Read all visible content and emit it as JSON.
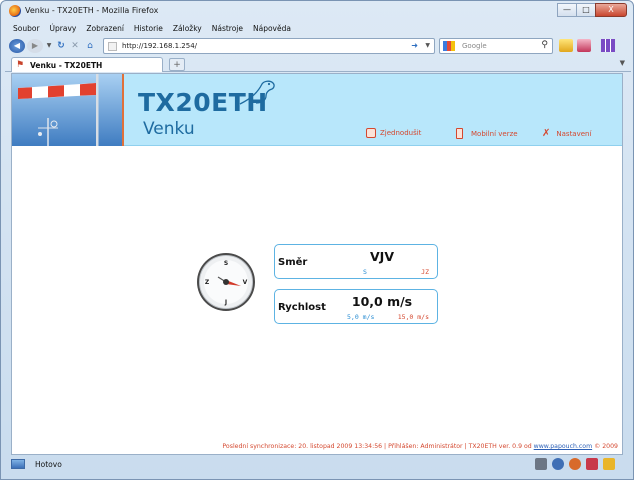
{
  "window": {
    "title": "Venku - TX20ETH - Mozilla Firefox",
    "controls": {
      "minimize": "—",
      "maximize": "□",
      "close": "X"
    }
  },
  "menu": [
    "Soubor",
    "Úpravy",
    "Zobrazení",
    "Historie",
    "Záložky",
    "Nástroje",
    "Nápověda"
  ],
  "nav": {
    "url": "http://192.168.1.254/",
    "search_placeholder": "Google"
  },
  "tab": {
    "title": "Venku - TX20ETH",
    "new_tab": "+"
  },
  "page": {
    "brand": "TX20ETH",
    "subtitle": "Venku",
    "links": [
      "Zjednodušit",
      "Mobilní verze",
      "Nastavení"
    ],
    "compass": {
      "n": "S",
      "e": "V",
      "s": "J",
      "w": "Z"
    },
    "direction": {
      "label": "Směr",
      "value": "VJV",
      "left": "S",
      "right": "JZ"
    },
    "speed": {
      "label": "Rychlost",
      "value": "10,0 m/s",
      "left": "5,0 m/s",
      "right": "15,0 m/s"
    },
    "footer": {
      "sync": "Poslední synchronizace: 20. listopad 2009 13:34:56 | Přihlášen: Administrátor | TX20ETH ver. 0.9 od",
      "link": "www.papouch.com",
      "copyright": "© 2009"
    }
  },
  "status": {
    "text": "Hotovo"
  }
}
